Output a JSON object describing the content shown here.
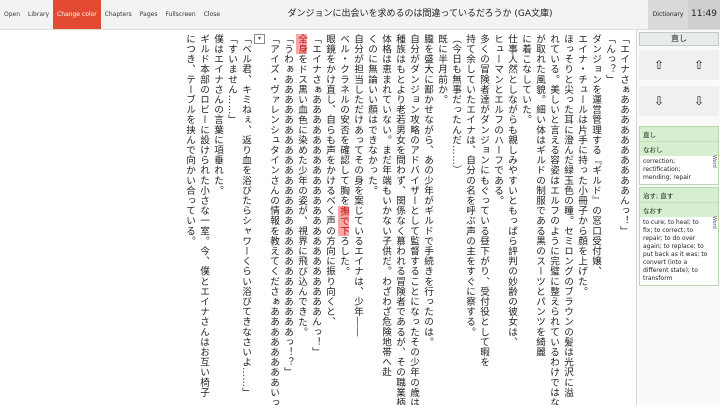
{
  "menu": {
    "items": [
      "Open",
      "Library",
      "Change color",
      "Chapters",
      "Pages",
      "Fullscreen",
      "Close"
    ],
    "active": "Change color"
  },
  "title": "ダンジョンに出会いを求めるのは間違っているだろうか (GA文庫)",
  "dictionary_button": "Dictionary",
  "clock": "11:49",
  "reader": {
    "lines": [
      "「エイナさぁああああああああああんっ！」",
      "「んっ？」",
      "ダンジョンを運営管理する『ギルド』の窓口受付嬢、",
      "エイナ・チュールは片手に持った小冊子から顔を上げた。",
      "ほっそりと尖った耳に澄んだ緑玉色の瞳。セミロングのブラウンの髪は光沢に溢",
      "れている。美しいと言える容姿はエルフのように完璧に整えられているわけではなく、どこか角",
      "が取れた風貌。細い体はギルドの制服である黒のスーツとパンツを綺麗",
      "に着こなしていた。",
      "仕事人然としながらも親しみやすいともっぱら評判の妙齢の彼女は、",
      "ヒューマンとエルフのハーフである。",
      "多くの冒険者達がダンジョンにもぐっている昼下がり、受付役として暇を",
      "持て余していたエイナは、自分の名を呼ぶ声の主をすぐに察する。",
      "（今日も無事だったんだ……）",
      "既に半月前か。",
      "朧を盛大に鄙かせながら、あの少年がギルドで手続きを行ったのは。",
      "自分がダンジョン攻略のアドバイザーとして監督することになったその少年の歳は十四。",
      "種族はもとより老若男女を問わず、関係なく慕われる冒険者であるが、その職業柄、",
      "体格は恵まれていない。まだ年端もいかない子供だ。わざわざ危険地帯へ赴",
      "くのに無論いい顔はできなかった。",
      "自分が担当しただけあってその身を案じているエイナは、少年――",
      "ベル・クラネルの安否を確認して胸を撫で下ろした。",
      "眼鏡をかけ直し、自らも声をかけるべく声の方向に振り向くと、",
      "「エイナさぁああああああああああああああああああああああんっ！」",
      "全身をドス黒い血色に染めた少年の姿が、視界に飛び込んできた。",
      "「うわぁああああああああああああああああああああああああああっ！？」",
      "「アイズ・ヴァレンシュタインさんの情報を教えてくださぁああああああああいっ！」",
      "",
      "「ベル君、キミねぇ、返り血を浴びたらシャワーくらい浴びてきなさいよ……」",
      "「すいません……」",
      "僕はエイナさんの言葉に項垂れた。",
      "ギルド本部のロビーに設けられた小さな一室。今、僕とエイナさんはお互い椅子",
      "につき、テーブルを挟んで向かい合っている。"
    ],
    "highlights": [
      "撫で下",
      "全身"
    ],
    "marker": "▾"
  },
  "dictionary": {
    "search_value": "直し",
    "arrows": [
      "⇧",
      "⇧",
      "⇩",
      "⇩"
    ],
    "entries": [
      {
        "head": "直し",
        "reading": "なおし",
        "definitions": "correction; rectification; mending; repair",
        "tag": "Word"
      },
      {
        "head": "治す; 直す",
        "reading": "なおす",
        "definitions": "to cure; to heal; to fix; to correct; to repair; to do over again; to replace; to put back as it was; to convert (into a different state); to transform",
        "tag": "Word"
      }
    ]
  }
}
